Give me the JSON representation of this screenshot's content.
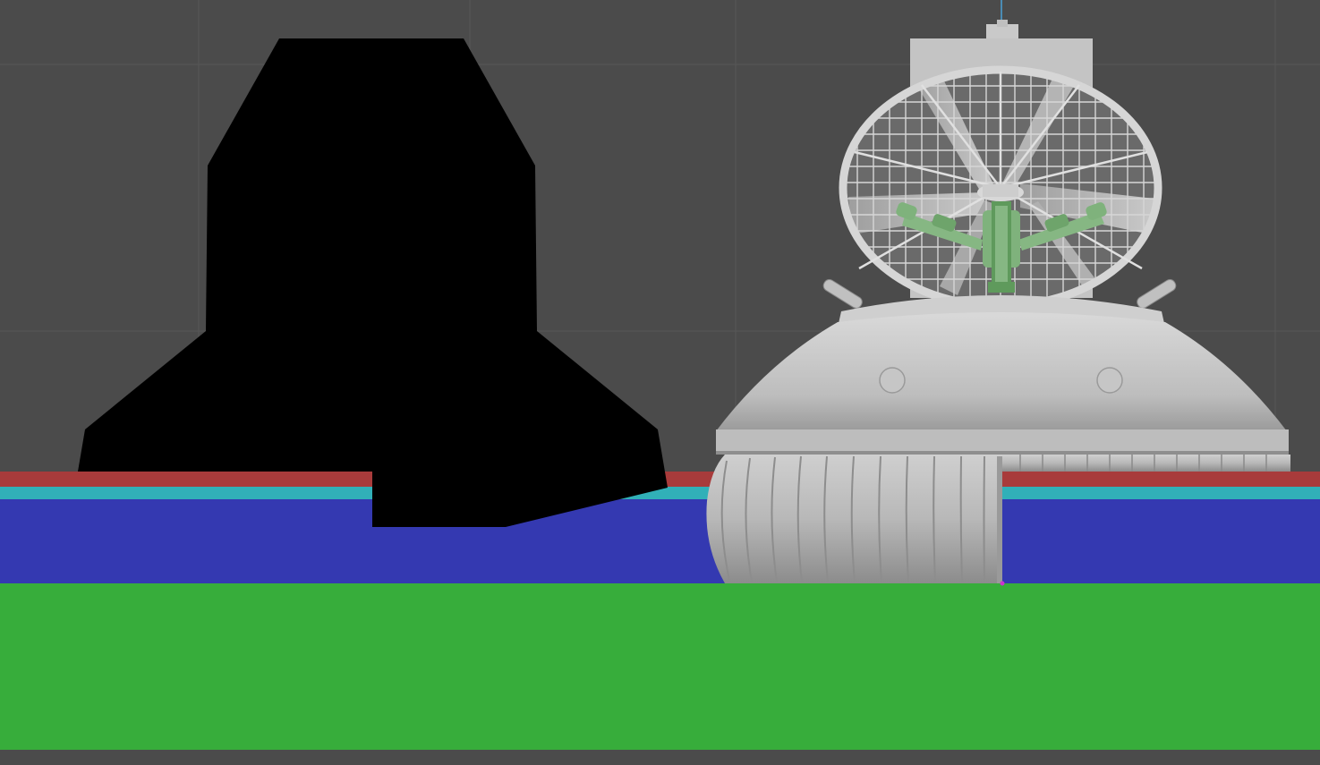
{
  "viewport": {
    "mode": "orthographic-front",
    "colors": {
      "background": "#4b4b4b",
      "grid_line": "#585858",
      "axis_line": "#4aa3d8",
      "silhouette": "#000000",
      "band_red": "#a83b3b",
      "band_cyan": "#31b0b8",
      "band_blue": "#3439b1",
      "band_green": "#37ad3b",
      "model_light": "#d2d2d2",
      "model_mid": "#a9a9a9",
      "model_dark": "#777777",
      "fan_guard": "#cfcfcf",
      "controls": "#7fb27c",
      "controls_dark": "#4e8a4b",
      "vertex_marker": "#cc33cc"
    }
  },
  "scene": {
    "layers": [
      {
        "id": "band-red",
        "color_key": "band_red"
      },
      {
        "id": "band-cyan",
        "color_key": "band_cyan"
      },
      {
        "id": "band-blue",
        "color_key": "band_blue"
      },
      {
        "id": "band-green",
        "color_key": "band_green"
      }
    ],
    "objects": [
      {
        "id": "reference-silhouette",
        "icon": "silhouette-mesh-icon",
        "color_key": "silhouette"
      },
      {
        "id": "hovercraft-model",
        "icon": "hovercraft-mesh-icon",
        "color_key": "model_light"
      }
    ]
  }
}
